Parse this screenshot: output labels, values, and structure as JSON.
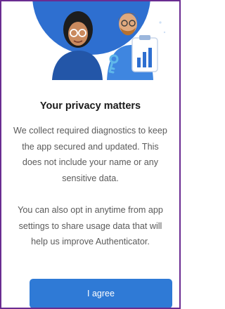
{
  "privacy": {
    "title": "Your privacy matters",
    "paragraph1": "We collect required diagnostics to keep the app secured and updated. This does not include your name or any sensitive data.",
    "paragraph2": "You can also opt in anytime from app settings to share usage data that will help us improve Authenticator.",
    "agree_label": "I agree"
  },
  "colors": {
    "accent": "#2f7ad6",
    "window_border": "#6a2c91",
    "title": "#1b1b1b",
    "body": "#5a5a5a"
  },
  "icons": [
    "people-illustration",
    "key-icon",
    "chart-clipboard-icon"
  ]
}
